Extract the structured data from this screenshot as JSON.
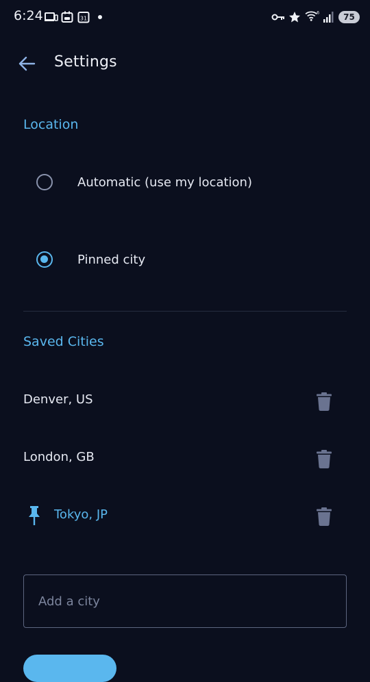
{
  "status_bar": {
    "time": "6:24",
    "battery": "75",
    "icons": [
      "cast-icon",
      "calendar-small-icon",
      "calendar-31-icon",
      "notification-dot",
      "vpn-key-icon",
      "star-icon",
      "wifi-6-icon",
      "signal-icon",
      "battery-icon"
    ]
  },
  "header": {
    "title": "Settings",
    "back_icon": "arrow-left-icon"
  },
  "location": {
    "section_title": "Location",
    "options": [
      {
        "label": "Automatic (use my location)",
        "selected": false
      },
      {
        "label": "Pinned city",
        "selected": true
      }
    ]
  },
  "saved_cities": {
    "section_title": "Saved Cities",
    "items": [
      {
        "name": "Denver, US",
        "pinned": false
      },
      {
        "name": "London, GB",
        "pinned": false
      },
      {
        "name": "Tokyo, JP",
        "pinned": true
      }
    ]
  },
  "add_city": {
    "placeholder": "Add a city",
    "value": ""
  },
  "colors": {
    "background": "#0b0f1e",
    "accent": "#5ab7ee",
    "text": "#e6e9f2",
    "muted_icon": "#6a7390",
    "divider": "#262c40"
  }
}
